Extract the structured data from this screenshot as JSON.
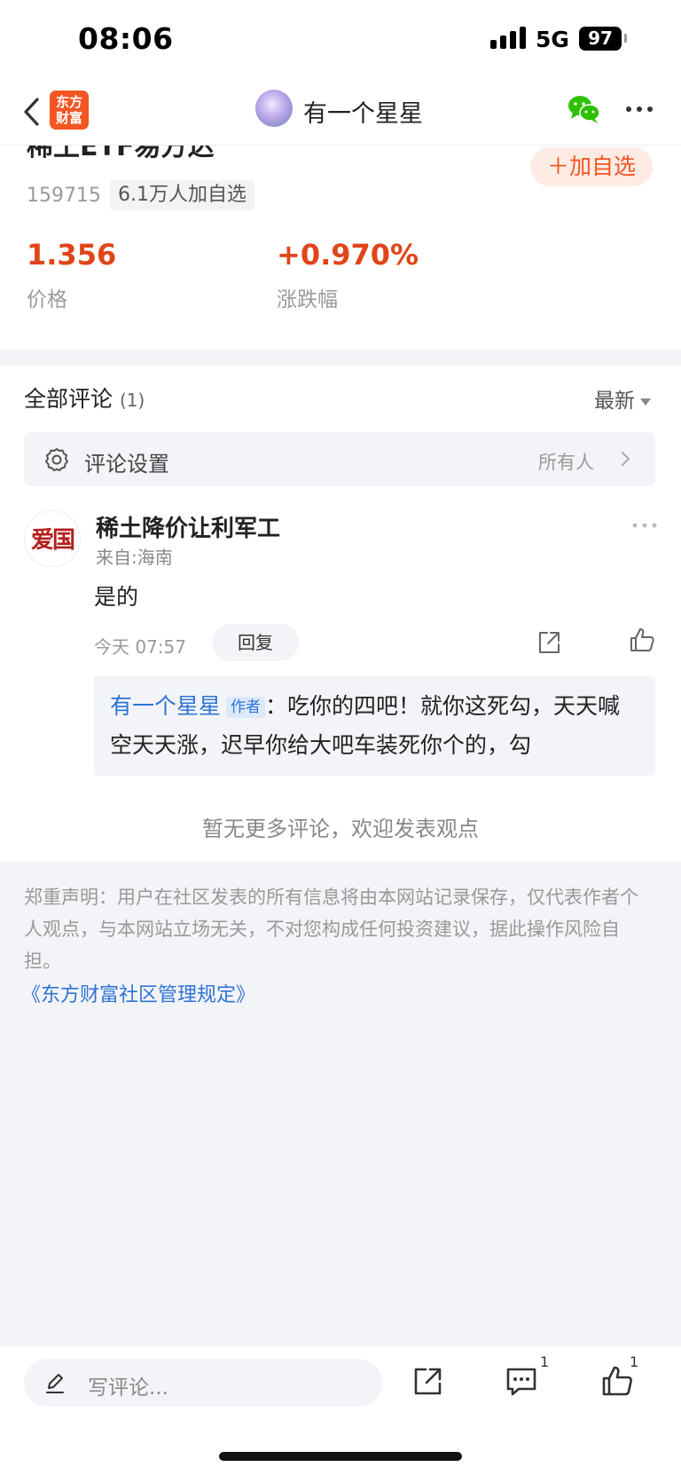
{
  "status_bar": {
    "time": "08:06",
    "network": "5G",
    "battery": "97"
  },
  "nav": {
    "logo_text": "东方财富",
    "title": "有一个星星"
  },
  "stock": {
    "name": "稀土ETF易方达",
    "code": "159715",
    "watch_count": "6.1万人加自选",
    "add_watch_label": "＋加自选",
    "price": "1.356",
    "price_label": "价格",
    "change": "+0.970%",
    "change_label": "涨跌幅"
  },
  "comments_section": {
    "title": "全部评论",
    "count": "(1)",
    "sort_label": "最新",
    "settings_label": "评论设置",
    "settings_value": "所有人"
  },
  "comment": {
    "avatar_text": "爱国",
    "user_name": "稀土降价让利军工",
    "location": "来自:海南",
    "text": "是的",
    "time": "今天 07:57",
    "reply_label": "回复",
    "reply": {
      "author": "有一个星星",
      "author_tag": "作者",
      "text": "：吃你的四吧！就你这死勾，天天喊空天天涨，迟早你给大吧车装死你个的，勾"
    }
  },
  "no_more_text": "暂无更多评论，欢迎发表观点",
  "disclaimer": {
    "text": "郑重声明：用户在社区发表的所有信息将由本网站记录保存，仅代表作者个人观点，与本网站立场无关，不对您构成任何投资建议，据此操作风险自担。",
    "link": "《东方财富社区管理规定》"
  },
  "bottom_bar": {
    "input_placeholder": "写评论...",
    "comment_count": "1",
    "like_count": "1"
  },
  "colors": {
    "accent": "#f35523",
    "price_red": "#e0451a",
    "link_blue": "#2f73d6",
    "background_gray": "#f3f4f7"
  }
}
